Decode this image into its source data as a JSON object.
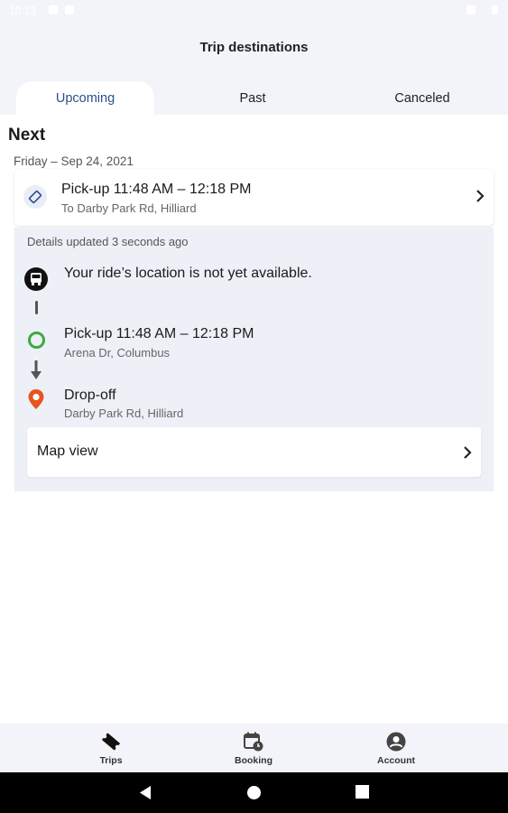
{
  "status_bar": {
    "time": "10:13"
  },
  "header": {
    "title": "Trip destinations"
  },
  "tabs": [
    {
      "label": "Upcoming",
      "active": true
    },
    {
      "label": "Past",
      "active": false
    },
    {
      "label": "Canceled",
      "active": false
    }
  ],
  "next": {
    "heading": "Next",
    "date": "Friday – Sep 24, 2021",
    "trip": {
      "icon": "ticket-icon",
      "title": "Pick-up 11:48 AM – 12:18 PM",
      "subtitle": "To Darby Park Rd, Hilliard"
    }
  },
  "details": {
    "updated": "Details updated 3 seconds ago",
    "location_message": "Your ride’s location is not yet available.",
    "pickup": {
      "title": "Pick-up 11:48 AM – 12:18 PM",
      "address": "Arena Dr, Columbus"
    },
    "dropoff": {
      "title": "Drop-off",
      "address": "Darby Park Rd, Hilliard"
    },
    "map_view_label": "Map view"
  },
  "bottom_nav": [
    {
      "label": "Trips",
      "icon": "ticket-icon",
      "active": true
    },
    {
      "label": "Booking",
      "icon": "calendar-clock-icon",
      "active": false
    },
    {
      "label": "Account",
      "icon": "account-circle-icon",
      "active": false
    }
  ],
  "colors": {
    "accent": "#2b4f8c",
    "pickup_green": "#3ea845",
    "dropoff_orange": "#e8541f",
    "background": "#f3f4fa"
  }
}
